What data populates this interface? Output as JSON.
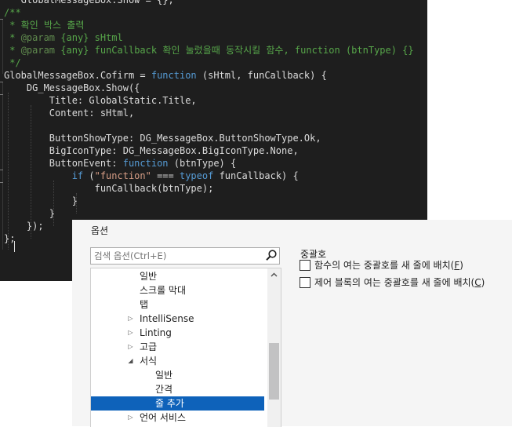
{
  "editor": {
    "lines": [
      [
        {
          "t": "c-ident",
          "v": "   GlobalMessageBox.Show = {};"
        }
      ],
      [
        {
          "t": "c-comment",
          "v": "/**"
        }
      ],
      [
        {
          "t": "c-comment",
          "v": " * 확인 박스 출력"
        }
      ],
      [
        {
          "t": "c-comment",
          "v": " * "
        },
        {
          "t": "c-doctag",
          "v": "@param"
        },
        {
          "t": "c-comment",
          "v": " {any} sHtml"
        }
      ],
      [
        {
          "t": "c-comment",
          "v": " * "
        },
        {
          "t": "c-doctag",
          "v": "@param"
        },
        {
          "t": "c-comment",
          "v": " {any} funCallback 확인 눌렀을때 동작시킬 함수, function (btnType) {}"
        }
      ],
      [
        {
          "t": "c-comment",
          "v": " */"
        }
      ],
      [
        {
          "t": "c-ident",
          "v": "GlobalMessageBox.Cofirm = "
        },
        {
          "t": "c-keyword",
          "v": "function"
        },
        {
          "t": "c-ident",
          "v": " (sHtml, funCallback) {"
        }
      ],
      [
        {
          "t": "c-ident",
          "v": "    DG_MessageBox.Show({"
        }
      ],
      [
        {
          "t": "c-ident",
          "v": "        Title: GlobalStatic.Title,"
        }
      ],
      [
        {
          "t": "c-ident",
          "v": "        Content: sHtml,"
        }
      ],
      [
        {
          "t": "c-ident",
          "v": ""
        }
      ],
      [
        {
          "t": "c-ident",
          "v": "        ButtonShowType: DG_MessageBox.ButtonShowType.Ok,"
        }
      ],
      [
        {
          "t": "c-ident",
          "v": "        BigIconType: DG_MessageBox.BigIconType.None,"
        }
      ],
      [
        {
          "t": "c-ident",
          "v": "        ButtonEvent: "
        },
        {
          "t": "c-keyword",
          "v": "function"
        },
        {
          "t": "c-ident",
          "v": " (btnType) {"
        }
      ],
      [
        {
          "t": "c-ident",
          "v": "            "
        },
        {
          "t": "c-keyword",
          "v": "if"
        },
        {
          "t": "c-ident",
          "v": " ("
        },
        {
          "t": "c-string",
          "v": "\"function\""
        },
        {
          "t": "c-ident",
          "v": " === "
        },
        {
          "t": "c-keyword",
          "v": "typeof"
        },
        {
          "t": "c-ident",
          "v": " funCallback) {"
        }
      ],
      [
        {
          "t": "c-ident",
          "v": "                funCallback(btnType);"
        }
      ],
      [
        {
          "t": "c-ident",
          "v": "            }"
        }
      ],
      [
        {
          "t": "c-ident",
          "v": "        }"
        }
      ],
      [
        {
          "t": "c-ident",
          "v": "    });"
        }
      ],
      [
        {
          "t": "c-ident",
          "v": "};"
        }
      ]
    ]
  },
  "dialog": {
    "title": "옵션",
    "search_placeholder": "검색 옵션(Ctrl+E)",
    "tree": [
      {
        "label": "일반",
        "indent": 1,
        "arrow": ""
      },
      {
        "label": "스크롤 막대",
        "indent": 1,
        "arrow": ""
      },
      {
        "label": "탭",
        "indent": 1,
        "arrow": ""
      },
      {
        "label": "IntelliSense",
        "indent": 1,
        "arrow": "collapsed"
      },
      {
        "label": "Linting",
        "indent": 1,
        "arrow": "collapsed"
      },
      {
        "label": "고급",
        "indent": 1,
        "arrow": "collapsed"
      },
      {
        "label": "서식",
        "indent": 1,
        "arrow": "expanded"
      },
      {
        "label": "일반",
        "indent": 2,
        "arrow": ""
      },
      {
        "label": "간격",
        "indent": 2,
        "arrow": ""
      },
      {
        "label": "줄 추가",
        "indent": 2,
        "arrow": "",
        "selected": true
      },
      {
        "label": "언어 서비스",
        "indent": 1,
        "arrow": "collapsed"
      }
    ],
    "group_title": "중괄호",
    "options": [
      {
        "label": "함수의 여는 중괄호를 새 줄에 배치(",
        "hotkey": "F",
        "suffix": ")",
        "checked": false
      },
      {
        "label": "제어 블록의 여는 중괄호를 새 줄에 배치(",
        "hotkey": "C",
        "suffix": ")",
        "checked": false
      }
    ]
  },
  "colors": {
    "editor_bg": "#1e1e1e",
    "comment": "#57a64a",
    "keyword": "#569cd6",
    "string": "#d69d85",
    "selection": "#0e62ba",
    "dialog_bg": "#f5f5f5"
  }
}
